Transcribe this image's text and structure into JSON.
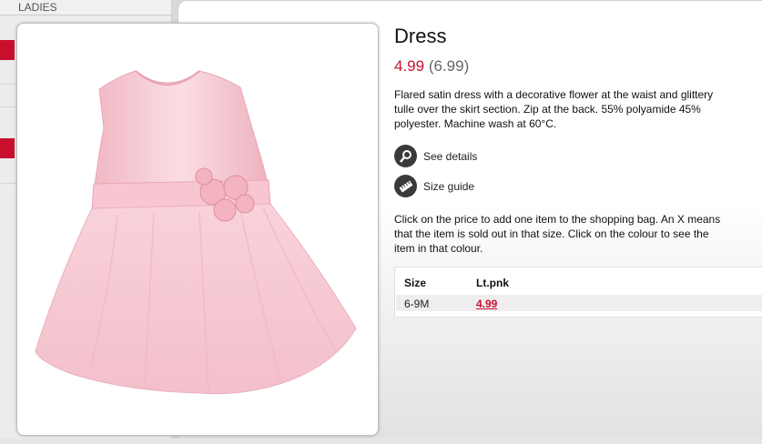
{
  "sidebar": {
    "header": "LADIES"
  },
  "product": {
    "title": "Dress",
    "price_now": "4.99",
    "price_old": "(6.99)",
    "description": "Flared satin dress with a decorative flower at the waist and glittery tulle over the skirt section. Zip at the back. 55% polyamide 45% polyester. Machine wash at 60°C.",
    "image_alt": "Light pink sleeveless dress with flower at waist"
  },
  "links": {
    "details": "See details",
    "size_guide": "Size guide"
  },
  "help_text": "Click on the price to add one item to the shopping bag. An X means that the item is sold out in that size. Click on the colour to see the item in that colour.",
  "size_table": {
    "headers": [
      "Size",
      "Lt.pnk"
    ],
    "rows": [
      {
        "size": "6-9M",
        "price": "4.99"
      }
    ]
  },
  "colors": {
    "accent": "#c8102e",
    "dress": "#f6cad3"
  },
  "icons": {
    "details": "magnifier-icon",
    "size_guide": "ruler-icon"
  }
}
